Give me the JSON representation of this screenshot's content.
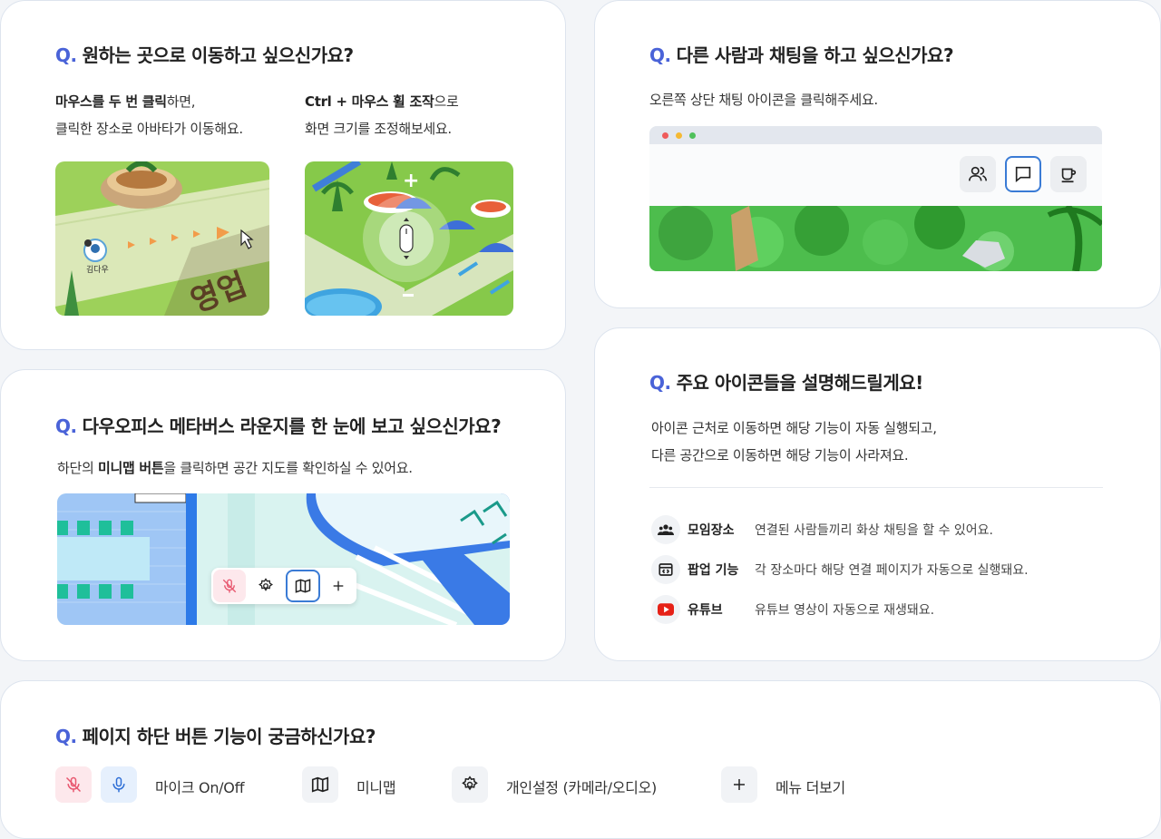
{
  "move": {
    "title": "원하는 곳으로 이동하고 싶으신가요?",
    "q_mark": "Q.",
    "left_bold": "마우스를 두 번 클릭",
    "left_rest": "하면,",
    "left_line2": "클릭한 장소로 아바타가 이동해요.",
    "right_bold": "Ctrl + 마우스 휠 조작",
    "right_rest": "으로",
    "right_line2": "화면 크기를 조정해보세요.",
    "avatar_name": "김다우"
  },
  "chat": {
    "title": "다른 사람과 채팅을 하고 싶으신가요?",
    "q_mark": "Q.",
    "desc": "오른쪽 상단 채팅 아이콘을 클릭해주세요."
  },
  "lounge": {
    "title": "다우오피스 메타버스 라운지를 한 눈에 보고 싶으신가요?",
    "q_mark": "Q.",
    "desc_pre": "하단의 ",
    "desc_bold": "미니맵 버튼",
    "desc_post": "을 클릭하면 공간 지도를 확인하실 수 있어요."
  },
  "icons": {
    "title": "주요 아이콘들을 설명해드릴게요!",
    "q_mark": "Q.",
    "line1": "아이콘 근처로 이동하면 해당 기능이 자동 실행되고,",
    "line2": "다른 공간으로 이동하면 해당 기능이 사라져요.",
    "items": [
      {
        "icon": "group-icon",
        "name": "모임장소",
        "desc": "연결된 사람들끼리 화상 채팅을 할 수 있어요."
      },
      {
        "icon": "popup-icon",
        "name": "팝업 기능",
        "desc": "각 장소마다 해당 연결 페이지가 자동으로 실행돼요."
      },
      {
        "icon": "youtube-icon",
        "name": "유튜브",
        "desc": "유튜브 영상이 자동으로 재생돼요."
      }
    ]
  },
  "bottom": {
    "title": "페이지 하단 버튼 기능이 궁금하신가요?",
    "q_mark": "Q.",
    "mic_label": "마이크 On/Off",
    "minimap_label": "미니맵",
    "settings_label": "개인설정 (카메라/오디오)",
    "more_label": "메뉴 더보기"
  },
  "colors": {
    "accent": "#4a63d8",
    "mic_off_bg": "#fde8ec",
    "mic_on_bg": "#e6f0fd",
    "youtube": "#e62117",
    "grass": "#8cc63f"
  }
}
